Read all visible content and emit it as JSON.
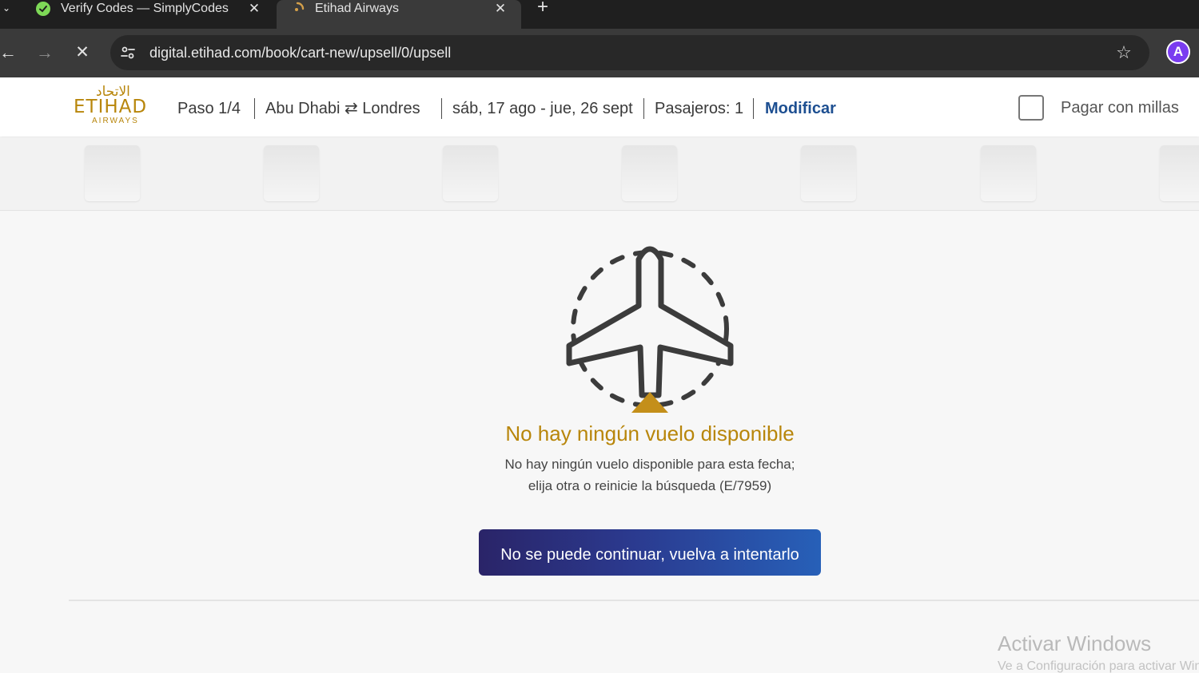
{
  "browser": {
    "tabs": [
      {
        "title": "Verify Codes — SimplyCodes",
        "close": "✕",
        "active": false
      },
      {
        "title": "Etihad Airways",
        "close": "✕",
        "active": true
      }
    ],
    "new_tab": "+",
    "url": "digital.etihad.com/book/cart-new/upsell/0/upsell",
    "profile_initial": "A",
    "icons": {
      "back": "back-arrow-icon",
      "forward": "forward-arrow-icon",
      "stop": "stop-loading-icon",
      "site_info": "site-settings-icon",
      "bookmark": "star-icon"
    }
  },
  "header": {
    "logo": {
      "arabic": "الاتحاد",
      "name": "ETIHAD",
      "sub": "AIRWAYS"
    },
    "step": "Paso 1/4",
    "route": {
      "origin": "Abu Dhabi",
      "arrow": "⇄",
      "destination": "Londres"
    },
    "dates": "sáb, 17 ago - jue, 26 sept",
    "passengers": "Pasajeros: 1",
    "modify": "Modificar",
    "pay_with_miles": "Pagar con millas"
  },
  "empty_state": {
    "title": "No hay ningún vuelo disponible",
    "message_line1": "No hay ningún vuelo disponible para esta fecha;",
    "message_line2": "elija otra o reinicie la búsqueda (E/7959)",
    "button_label": "No se puede continuar, vuelva a intentarlo"
  },
  "watermark": {
    "title": "Activar Windows",
    "subtitle": "Ve a Configuración para activar Windows."
  },
  "colors": {
    "brand_gold": "#b8860b",
    "brand_blue": "#1d4f91",
    "button_gradient_start": "#2a2468",
    "button_gradient_end": "#2760b8",
    "chrome_dark": "#1f1f1f"
  }
}
